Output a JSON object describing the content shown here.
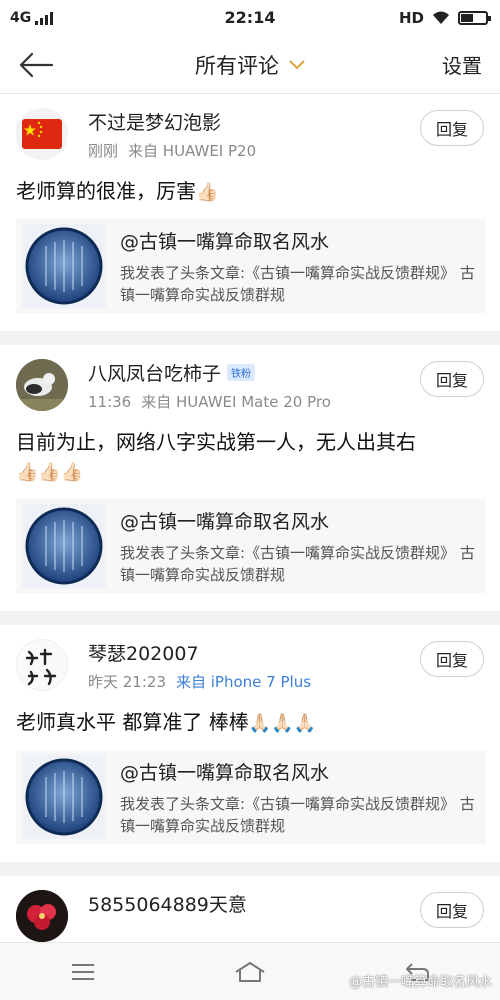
{
  "status": {
    "network": "4G",
    "time": "22:14",
    "hd": "HD"
  },
  "header": {
    "back_icon": "arrow-left-icon",
    "title": "所有评论",
    "dropdown_icon": "chevron-down-icon",
    "settings_label": "设置"
  },
  "comments": [
    {
      "name": "不过是梦幻泡影",
      "badge": "",
      "time": "刚刚",
      "source": "来自 HUAWEI P20",
      "source_color": "#8a8a8a",
      "text": "老师算的很准，厉害",
      "thumbs": "👍🏻",
      "reply": "回复",
      "avatar_icon": "china-flag-icon",
      "article": {
        "title": "@古镇一嘴算命取名风水",
        "desc": "我发表了头条文章:《古镇一嘴算命实战反馈群规》 古镇一嘴算命实战反馈群规"
      }
    },
    {
      "name": "八风凤台吃柿子",
      "badge": "铁粉",
      "time": "11:36",
      "source": "来自 HUAWEI Mate 20 Pro",
      "source_color": "#8a8a8a",
      "text": "目前为止，网络八字实战第一人，无人出其右",
      "thumbs": "👍🏻👍🏻👍🏻",
      "reply": "回复",
      "avatar_icon": "bird-photo-icon",
      "article": {
        "title": "@古镇一嘴算命取名风水",
        "desc": "我发表了头条文章:《古镇一嘴算命实战反馈群规》 古镇一嘴算命实战反馈群规"
      }
    },
    {
      "name": "琴瑟202007",
      "badge": "",
      "time": "昨天 21:23",
      "source": "来自 iPhone 7 Plus",
      "source_color": "#3d7fd8",
      "text": "老师真水平 都算准了 棒棒",
      "thumbs": "🙏🏻🙏🏻🙏🏻",
      "reply": "回复",
      "avatar_icon": "calligraphy-avatar-icon",
      "article": {
        "title": "@古镇一嘴算命取名风水",
        "desc": "我发表了头条文章:《古镇一嘴算命实战反馈群规》 古镇一嘴算命实战反馈群规"
      }
    },
    {
      "name": "5855064889天意",
      "badge": "",
      "time": "",
      "source": "",
      "source_color": "#8a8a8a",
      "text": "",
      "thumbs": "",
      "reply": "回复",
      "avatar_icon": "flower-avatar-icon",
      "article": null
    }
  ],
  "nav": {
    "menu_icon": "menu-icon",
    "home_icon": "home-icon",
    "back_icon": "return-icon"
  },
  "watermark": "@古镇一嘴算命取名风水"
}
